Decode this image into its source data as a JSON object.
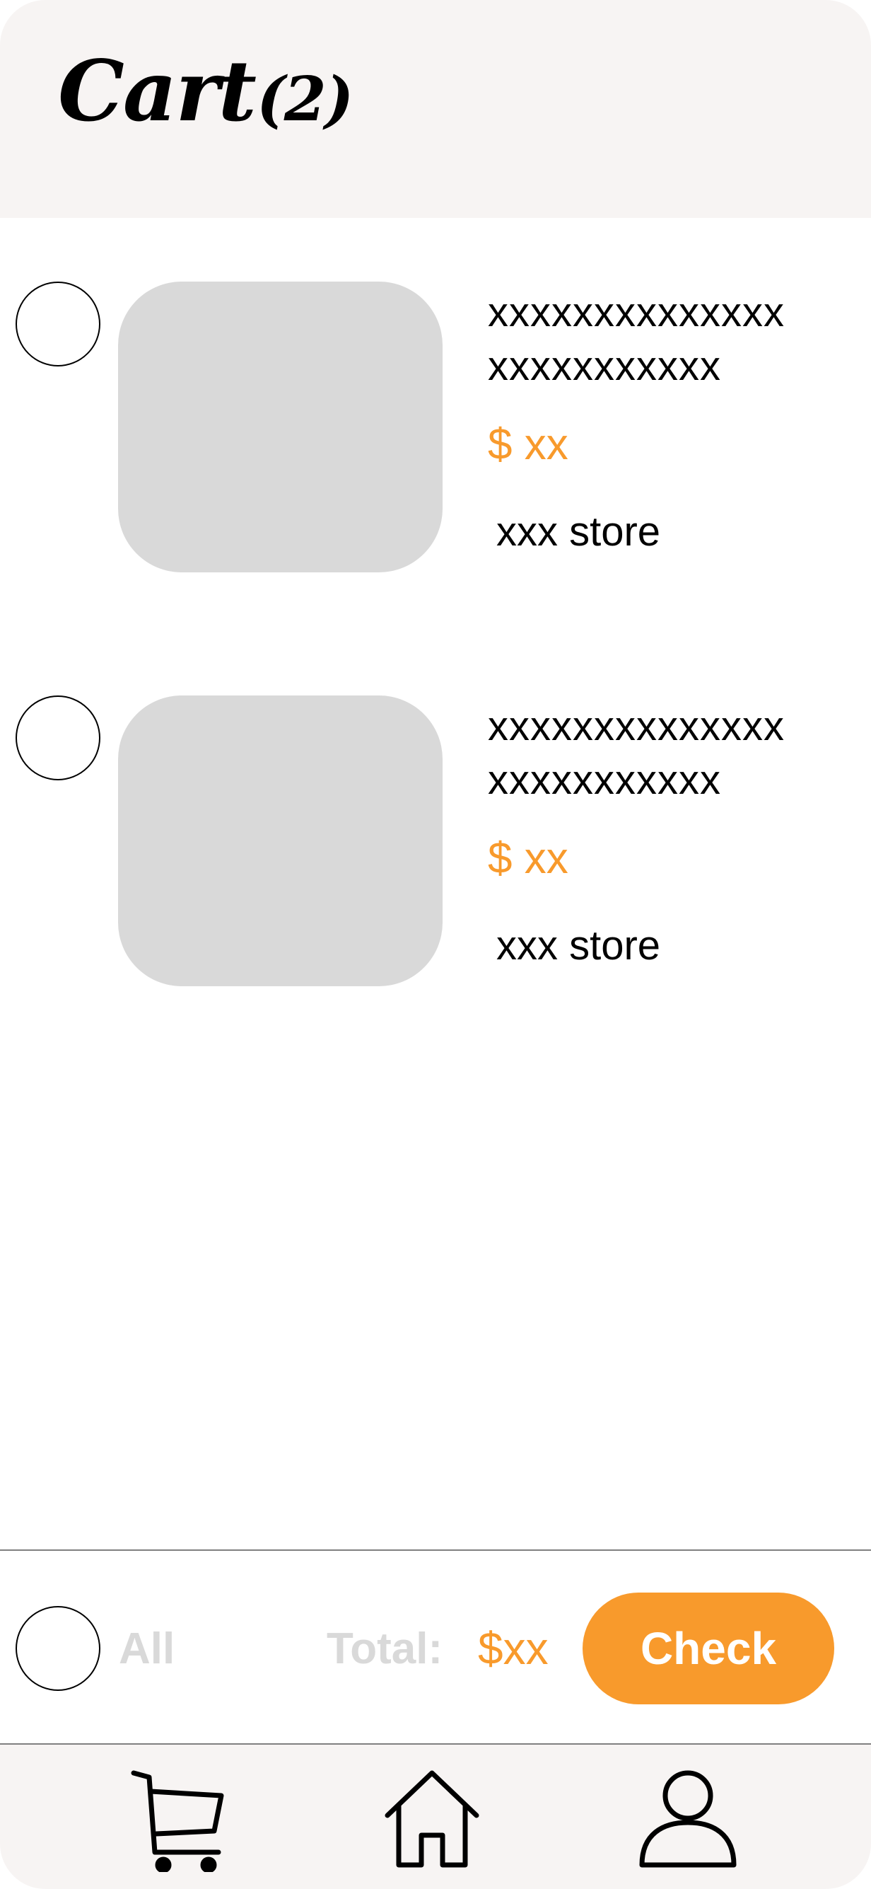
{
  "header": {
    "title": "Cart",
    "count": "(2)"
  },
  "items": [
    {
      "name": "xxxxxxxxxxxxxx\nxxxxxxxxxxx",
      "price": "$ xx",
      "store": "xxx store"
    },
    {
      "name": "xxxxxxxxxxxxxx\nxxxxxxxxxxx",
      "price": "$ xx",
      "store": "xxx store"
    }
  ],
  "footer": {
    "select_all_label": "All",
    "total_label": "Total:",
    "total_value": "$xx",
    "check_label": "Check"
  },
  "nav": {
    "items": [
      {
        "icon": "cart-icon"
      },
      {
        "icon": "home-icon"
      },
      {
        "icon": "profile-icon"
      }
    ]
  },
  "colors": {
    "accent": "#f89a2c",
    "header_bg": "#f7f4f3",
    "placeholder": "#d9d9d9",
    "muted_text": "#d9d9d9"
  }
}
